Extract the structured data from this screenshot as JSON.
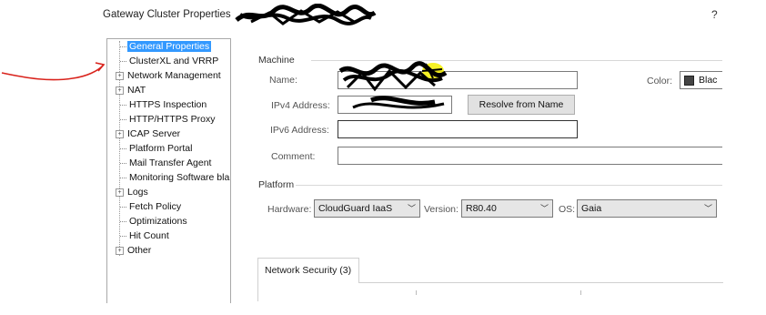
{
  "window": {
    "title": "Gateway Cluster Properties",
    "help": "?"
  },
  "tree": {
    "items": [
      {
        "label": "General Properties",
        "expandable": false,
        "selected": true
      },
      {
        "label": "ClusterXL and VRRP",
        "expandable": false,
        "selected": false
      },
      {
        "label": "Network Management",
        "expandable": true,
        "selected": false
      },
      {
        "label": "NAT",
        "expandable": true,
        "selected": false
      },
      {
        "label": "HTTPS Inspection",
        "expandable": false,
        "selected": false
      },
      {
        "label": "HTTP/HTTPS Proxy",
        "expandable": false,
        "selected": false
      },
      {
        "label": "ICAP Server",
        "expandable": true,
        "selected": false
      },
      {
        "label": "Platform Portal",
        "expandable": false,
        "selected": false
      },
      {
        "label": "Mail Transfer Agent",
        "expandable": false,
        "selected": false
      },
      {
        "label": "Monitoring Software bla",
        "expandable": false,
        "selected": false
      },
      {
        "label": "Logs",
        "expandable": true,
        "selected": false
      },
      {
        "label": "Fetch Policy",
        "expandable": false,
        "selected": false
      },
      {
        "label": "Optimizations",
        "expandable": false,
        "selected": false
      },
      {
        "label": "Hit Count",
        "expandable": false,
        "selected": false
      },
      {
        "label": "Other",
        "expandable": true,
        "selected": false
      }
    ],
    "expander_glyph": "+"
  },
  "machine": {
    "group_label": "Machine",
    "name_label": "Name:",
    "name_value": "",
    "ipv4_label": "IPv4 Address:",
    "ipv4_value": "",
    "resolve_button": "Resolve from Name",
    "ipv6_label": "IPv6 Address:",
    "ipv6_value": "",
    "comment_label": "Comment:",
    "comment_value": "",
    "color_label": "Color:",
    "color_value": "Blac",
    "color_swatch": "#444444"
  },
  "platform": {
    "group_label": "Platform",
    "hardware_label": "Hardware:",
    "hardware_value": "CloudGuard IaaS",
    "version_label": "Version:",
    "version_value": "R80.40",
    "os_label": "OS:",
    "os_value": "Gaia",
    "chevron": "﹀"
  },
  "tabs": {
    "network_security": "Network Security (3)"
  },
  "annotation": {
    "color": "#d9231c",
    "highlight": "#f5f000"
  }
}
